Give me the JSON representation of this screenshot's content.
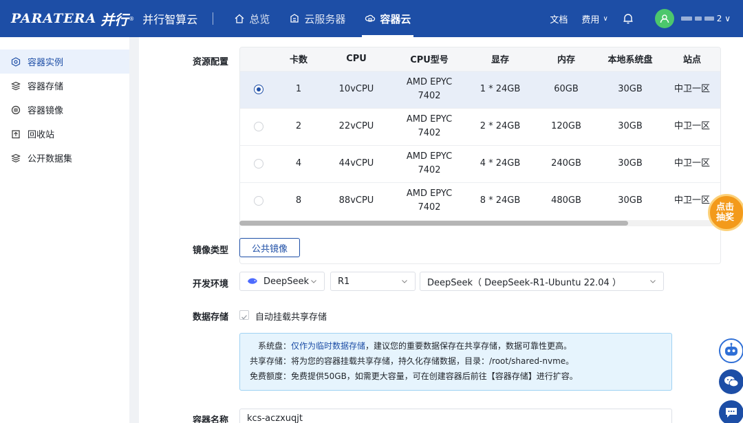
{
  "brand": {
    "logo_en": "PARATERA",
    "logo_cn": "并行",
    "registered": "®",
    "product": "并行智算云"
  },
  "nav": {
    "items": [
      {
        "label": "总览",
        "icon": "home-icon"
      },
      {
        "label": "云服务器",
        "icon": "cloud-server-icon"
      },
      {
        "label": "容器云",
        "icon": "container-cloud-icon"
      }
    ],
    "active": "容器云"
  },
  "topright": {
    "docs": "文档",
    "billing": "费用",
    "billing_chevron": "∨",
    "user_tail": "2 ∨"
  },
  "sidebar": {
    "items": [
      {
        "label": "容器实例",
        "icon": "container-instance-icon"
      },
      {
        "label": "容器存储",
        "icon": "storage-stack-icon"
      },
      {
        "label": "容器镜像",
        "icon": "image-disk-icon"
      },
      {
        "label": "回收站",
        "icon": "recycle-bin-icon"
      },
      {
        "label": "公开数据集",
        "icon": "dataset-icon"
      }
    ]
  },
  "form": {
    "resource_label": "资源配置",
    "image_type_label": "镜像类型",
    "image_type_button": "公共镜像",
    "dev_env_label": "开发环境",
    "dev_env": {
      "framework": "DeepSeek",
      "version": "R1",
      "image": "DeepSeek（ DeepSeek-R1-Ubuntu 22.04 ）"
    },
    "storage_label": "数据存储",
    "auto_mount_label": "自动挂载共享存储",
    "info": {
      "line1_prefix": "系统盘：",
      "line1_highlight": "仅作为临时数据存储",
      "line1_rest": "，建议您的重要数据保存在共享存储，数据可靠性更高。",
      "line2": "共享存储：将为您的容器挂载共享存储，持久化存储数据，目录：/root/shared-nvme。",
      "line3": "免费额度：免费提供50GB，如需更大容量，可在创建容器后前往【容器存储】进行扩容。"
    },
    "name_label": "容器名称",
    "name_value": "kcs-aczxuqjt"
  },
  "resource_table": {
    "headers": [
      "",
      "卡数",
      "CPU",
      "CPU型号",
      "显存",
      "内存",
      "本地系统盘",
      "站点"
    ],
    "rows": [
      {
        "selected": true,
        "cards": "1",
        "cpu": "10vCPU",
        "cpu_model_1": "AMD EPYC",
        "cpu_model_2": "7402",
        "vram": "1 * 24GB",
        "mem": "60GB",
        "disk": "30GB",
        "site": "中卫一区"
      },
      {
        "selected": false,
        "cards": "2",
        "cpu": "22vCPU",
        "cpu_model_1": "AMD EPYC",
        "cpu_model_2": "7402",
        "vram": "2 * 24GB",
        "mem": "120GB",
        "disk": "30GB",
        "site": "中卫一区"
      },
      {
        "selected": false,
        "cards": "4",
        "cpu": "44vCPU",
        "cpu_model_1": "AMD EPYC",
        "cpu_model_2": "7402",
        "vram": "4 * 24GB",
        "mem": "240GB",
        "disk": "30GB",
        "site": "中卫一区"
      },
      {
        "selected": false,
        "cards": "8",
        "cpu": "88vCPU",
        "cpu_model_1": "AMD EPYC",
        "cpu_model_2": "7402",
        "vram": "8 * 24GB",
        "mem": "480GB",
        "disk": "30GB",
        "site": "中卫一区"
      }
    ]
  },
  "widgets": {
    "lottery_line1": "点击",
    "lottery_line2": "抽奖"
  },
  "colors": {
    "primary": "#1d4ea6",
    "accent_green": "#4cc76c",
    "info_bg": "#e6f4fd",
    "lottery": "#f39a1b"
  }
}
